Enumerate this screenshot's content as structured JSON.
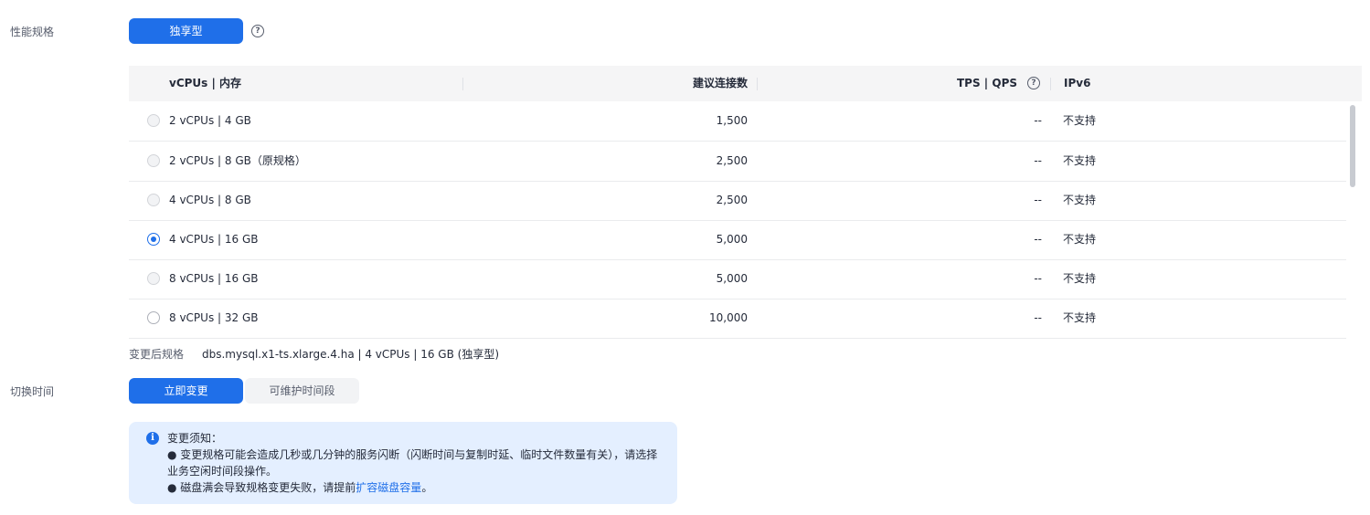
{
  "spec_section": {
    "label": "性能规格",
    "type_button": "独享型",
    "help_icon": "?"
  },
  "table": {
    "headers": {
      "vcpu_mem": "vCPUs | 内存",
      "connections": "建议连接数",
      "tps_qps": "TPS | QPS",
      "ipv6": "IPv6"
    },
    "rows": [
      {
        "spec": "2 vCPUs | 4 GB",
        "connections": "1,500",
        "tps_qps": "--",
        "ipv6": "不支持",
        "state": "disabled"
      },
      {
        "spec": "2 vCPUs | 8 GB（原规格）",
        "connections": "2,500",
        "tps_qps": "--",
        "ipv6": "不支持",
        "state": "disabled"
      },
      {
        "spec": "4 vCPUs | 8 GB",
        "connections": "2,500",
        "tps_qps": "--",
        "ipv6": "不支持",
        "state": "disabled"
      },
      {
        "spec": "4 vCPUs | 16 GB",
        "connections": "5,000",
        "tps_qps": "--",
        "ipv6": "不支持",
        "state": "checked"
      },
      {
        "spec": "8 vCPUs | 16 GB",
        "connections": "5,000",
        "tps_qps": "--",
        "ipv6": "不支持",
        "state": "disabled"
      },
      {
        "spec": "8 vCPUs | 32 GB",
        "connections": "10,000",
        "tps_qps": "--",
        "ipv6": "不支持",
        "state": "enabled"
      }
    ]
  },
  "changed_spec": {
    "label": "变更后规格",
    "value": "dbs.mysql.x1-ts.xlarge.4.ha | 4 vCPUs | 16 GB (独享型)"
  },
  "switch_time": {
    "label": "切换时间",
    "options": [
      "立即变更",
      "可维护时间段"
    ],
    "selected": "立即变更"
  },
  "notice": {
    "icon": "i",
    "title": "变更须知：",
    "line1": "● 变更规格可能会造成几秒或几分钟的服务闪断（闪断时间与复制时延、临时文件数量有关），请选择",
    "line2": "业务空闲时间段操作。",
    "line3_prefix": "● 磁盘满会导致规格变更失败，请提前",
    "line3_link": "扩容磁盘容量",
    "line3_suffix": "。"
  },
  "colors": {
    "primary": "#1f6fe9",
    "notice_bg": "#e4efff",
    "header_bg": "#f5f5f6"
  }
}
